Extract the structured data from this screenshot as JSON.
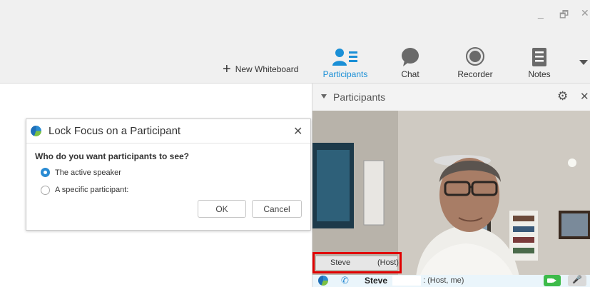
{
  "window_controls": {
    "minimize": "_",
    "maximize": "🗗",
    "close": "✕"
  },
  "toolbar": {
    "new_whiteboard": "New Whiteboard",
    "items": [
      {
        "label": "Participants",
        "icon": "participants-icon",
        "active": true
      },
      {
        "label": "Chat",
        "icon": "chat-icon",
        "active": false
      },
      {
        "label": "Recorder",
        "icon": "recorder-icon",
        "active": false
      },
      {
        "label": "Notes",
        "icon": "notes-icon",
        "active": false
      }
    ],
    "accent_color": "#1a8fd6"
  },
  "participants_panel": {
    "title": "Participants",
    "video_name": "Steve",
    "video_role": "(Host)",
    "row": {
      "name": "Steve",
      "role": ": (Host, me)"
    }
  },
  "dialog": {
    "title": "Lock Focus on a Participant",
    "question": "Who do you want participants to see?",
    "options": [
      {
        "label": "The active speaker",
        "selected": true
      },
      {
        "label": "A specific participant:",
        "selected": false
      }
    ],
    "ok_label": "OK",
    "cancel_label": "Cancel"
  },
  "highlight_color": "#e00000"
}
